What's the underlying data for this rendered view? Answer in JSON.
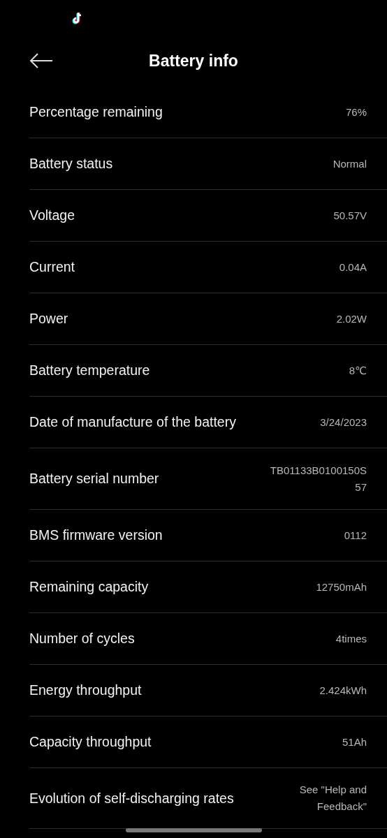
{
  "header": {
    "title": "Battery info"
  },
  "rows": [
    {
      "label": "Percentage remaining",
      "value": [
        "76%"
      ]
    },
    {
      "label": "Battery status",
      "value": [
        "Normal"
      ]
    },
    {
      "label": "Voltage",
      "value": [
        "50.57V"
      ]
    },
    {
      "label": "Current",
      "value": [
        "0.04A"
      ]
    },
    {
      "label": "Power",
      "value": [
        "2.02W"
      ]
    },
    {
      "label": "Battery temperature",
      "value": [
        "8℃"
      ]
    },
    {
      "label": "Date of manufacture of the battery",
      "value": [
        "3/24/2023"
      ]
    },
    {
      "label": "Battery serial number",
      "value": [
        "TB01133B0100150S",
        "57"
      ]
    },
    {
      "label": "BMS firmware version",
      "value": [
        "0112"
      ]
    },
    {
      "label": "Remaining capacity",
      "value": [
        "12750mAh"
      ]
    },
    {
      "label": "Number of cycles",
      "value": [
        "4times"
      ]
    },
    {
      "label": "Energy throughput",
      "value": [
        "2.424kWh"
      ]
    },
    {
      "label": "Capacity throughput",
      "value": [
        "51Ah"
      ]
    },
    {
      "label": "Evolution of self-discharging rates",
      "value": [
        "See \"Help and",
        "Feedback\""
      ]
    }
  ]
}
